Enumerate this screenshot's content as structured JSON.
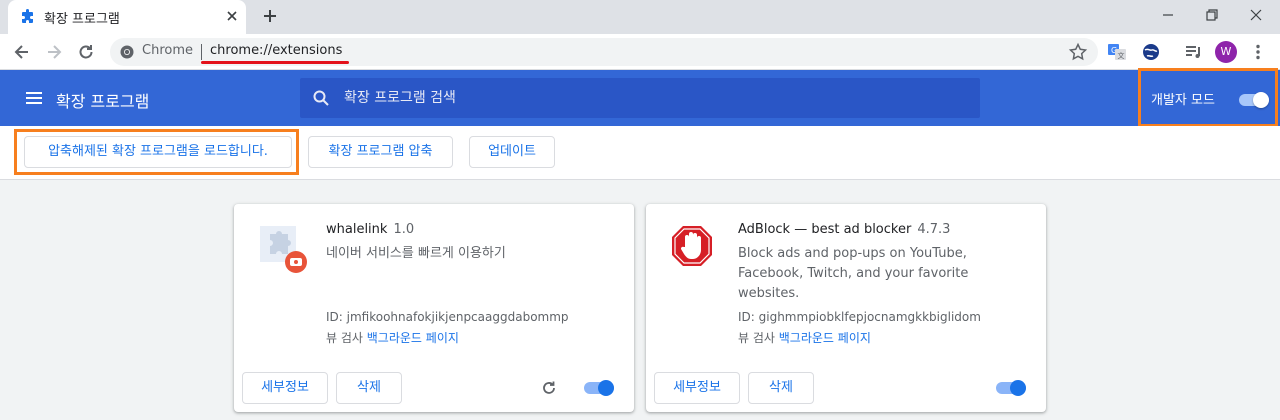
{
  "browser": {
    "tab_title": "확장 프로그램",
    "omnibox_site": "Chrome",
    "omnibox_url": "chrome://extensions",
    "avatar_letter": "W"
  },
  "header": {
    "title": "확장 프로그램",
    "search_placeholder": "확장 프로그램 검색",
    "devmode_label": "개발자 모드",
    "devmode_enabled": true
  },
  "actions": {
    "load_unpacked": "압축해제된 확장 프로그램을 로드합니다.",
    "pack": "확장 프로그램 압축",
    "update": "업데이트"
  },
  "extensions": [
    {
      "name": "whalelink",
      "version": "1.0",
      "description": "네이버 서비스를 빠르게 이용하기",
      "id_line": "ID: jmfikoohnafokjikjenpcaaggdabommp",
      "inspect_label": "뷰 검사",
      "inspect_link": "백그라운드 페이지",
      "details": "세부정보",
      "remove": "삭제",
      "enabled": true,
      "icon": "puzzle-piece-icon"
    },
    {
      "name": "AdBlock — best ad blocker",
      "version": "4.7.3",
      "description": "Block ads and pop-ups on YouTube, Facebook, Twitch, and your favorite websites.",
      "id_line": "ID: gighmmpiobklfepjocnamgkkbiglidom",
      "inspect_label": "뷰 검사",
      "inspect_link": "백그라운드 페이지",
      "details": "세부정보",
      "remove": "삭제",
      "enabled": true,
      "icon": "stop-hand-icon"
    }
  ],
  "colors": {
    "header_blue": "#3367d6",
    "highlight_orange": "#f77f1e",
    "accent_blue": "#1a73e8",
    "url_underline_red": "#e3121b"
  }
}
